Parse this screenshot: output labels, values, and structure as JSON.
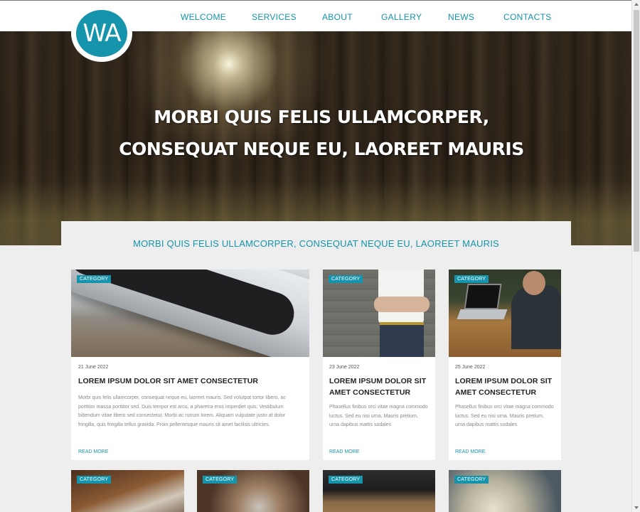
{
  "header": {
    "logo_text": "WA",
    "nav": [
      "WELCOME",
      "SERVICES",
      "ABOUT",
      "GALLERY",
      "NEWS",
      "CONTACTS"
    ]
  },
  "hero": {
    "line1": "MORBI QUIS FELIS ULLAMCORPER,",
    "line2": "CONSEQUAT NEQUE EU, LAOREET MAURIS"
  },
  "tagline": "MORBI QUIS FELIS ULLAMCORPER, CONSEQUAT NEQUE EU, LAOREET MAURIS",
  "cards": [
    {
      "category": "CATEGORY",
      "date": "21 June 2022",
      "title": "LOREM IPSUM DOLOR SIT AMET CONSECTETUR",
      "text": "Morbi quis felis ullamcorper, consequat neque eu, laoreet mauris. Sed volutpat tortor libero, ac porttitor massa porttitor sed. Duis tempor est arcu, a pharetra eros imperdiet quis. Vestibulum bibendum vitae libero sed consectetur. Morbi ac rutrum lorem. Aliquam vulputate justo at dolor fringilla, quis fringilla tellus gravida. Proin pellentesque mauris sit amet facilisis ultricies.",
      "read_more": "READ MORE"
    },
    {
      "category": "CATEGORY",
      "date": "23 June 2022",
      "title": "LOREM IPSUM DOLOR SIT AMET CONSECTETUR",
      "text": "Phasellus finibus orci vitae magna commodo luctus. Sed eu nisi urna. Mauris pretium, urna dapibus mattis sodales",
      "read_more": "READ MORE"
    },
    {
      "category": "CATEGORY",
      "date": "25 June 2022",
      "title": "LOREM IPSUM DOLOR SIT AMET CONSECTETUR",
      "text": "Phasellus finibus orci vitae magna commodo luctus. Sed eu nisi urna. Mauris pretium, urna dapibus mattis sodales",
      "read_more": "READ MORE"
    }
  ],
  "row2_badges": [
    "CATEGORY",
    "CATEGORY",
    "CATEGORY",
    "CATEGORY"
  ],
  "colors": {
    "accent": "#1594ab",
    "page_bg": "#eeeeee",
    "card_bg": "#ffffff"
  }
}
